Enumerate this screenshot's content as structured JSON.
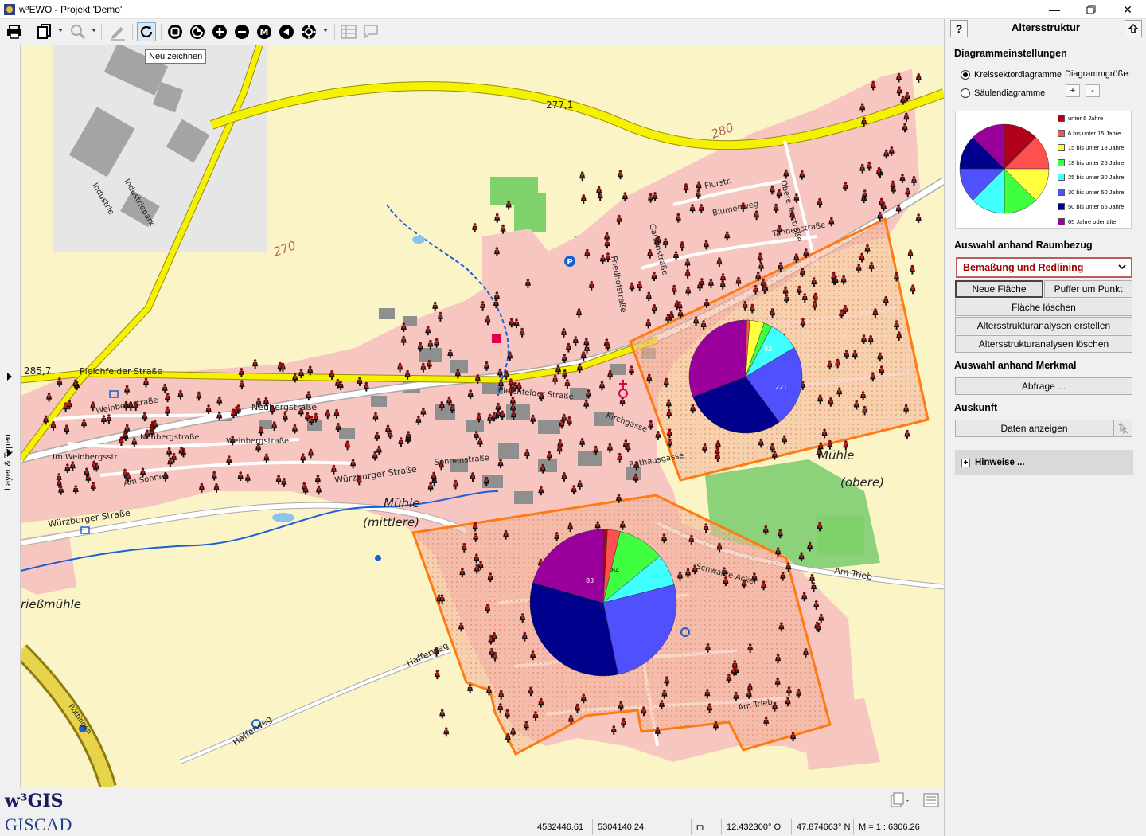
{
  "window": {
    "title": "w³EWO - Projekt 'Demo'"
  },
  "toolbar": {
    "tooltip": "Neu zeichnen"
  },
  "leftstrip": {
    "label": "Layer & Typen"
  },
  "map": {
    "labels": [
      "277,1",
      "280",
      "270",
      "285,7",
      "Pleichfelder Straße",
      "Neubergstraße",
      "Weinbergstraße",
      "Weinbergstraße",
      "Würzburger Straße",
      "Würzburger Straße",
      "Mühle",
      "(mittlere)",
      "Mühle",
      "(obere)",
      "Am Trieb",
      "Hafferweg",
      "Hafferweg",
      "Industriepark",
      "Industrie",
      "Blumenweg",
      "Tannenstraße",
      "Obere Torstraße",
      "Gartenstraße",
      "Friedhofstraße",
      "Pleichfelder Straße",
      "Kirchgasse",
      "Rathausgasse",
      "Schwarze Acker",
      "Am Trieb",
      "rießmühle",
      "Neubergstraße",
      "Sonnenstraße",
      "Am Sonnen",
      "82",
      "221",
      "84",
      "83",
      "Röttingen",
      "Im Weinbergsstr",
      "Flurstr."
    ]
  },
  "bottom": {
    "logo_top": "w³GIS",
    "logo_bottom": "GISCAD",
    "coord_x": "4532446.61",
    "coord_y": "5304140.24",
    "unit": "m",
    "lon": "12.432300° O",
    "lat": "47.874663° N",
    "scale_label": "M = 1 :",
    "scale_value": "6306.26"
  },
  "panel": {
    "title": "Altersstruktur",
    "help_label": "?",
    "diagram_settings_heading": "Diagrammeinstellungen",
    "radio_pie": "Kreissektordiagramme",
    "radio_bar": "Säulendiagramme",
    "size_label": "Diagrammgröße:",
    "size_plus": "+",
    "size_minus": "-",
    "legend": [
      {
        "label": "unter 6 Jahre",
        "color": "#b0001a"
      },
      {
        "label": "6 bis unter 15 Jahre",
        "color": "#ff5050"
      },
      {
        "label": "15 bis unter 18 Jahre",
        "color": "#ffff40"
      },
      {
        "label": "18 bis unter 25 Jahre",
        "color": "#40ff40"
      },
      {
        "label": "25 bis unter 30 Jahre",
        "color": "#40ffff"
      },
      {
        "label": "30 bis unter 50 Jahre",
        "color": "#5050ff"
      },
      {
        "label": "50 bis unter 65 Jahre",
        "color": "#00008c"
      },
      {
        "label": "65 Jahre oder älter",
        "color": "#9c009c"
      }
    ],
    "spatial_heading": "Auswahl anhand Raumbezug",
    "select_value": "Bemaßung und Redlining",
    "btn_new_area": "Neue Fläche",
    "btn_buffer": "Puffer um Punkt",
    "btn_delete_area": "Fläche löschen",
    "btn_create_analyses": "Altersstrukturanalysen erstellen",
    "btn_delete_analyses": "Altersstrukturanalysen löschen",
    "attribute_heading": "Auswahl anhand Merkmal",
    "btn_query": "Abfrage ...",
    "info_heading": "Auskunft",
    "btn_show_data": "Daten anzeigen",
    "hints_label": "Hinweise ..."
  }
}
